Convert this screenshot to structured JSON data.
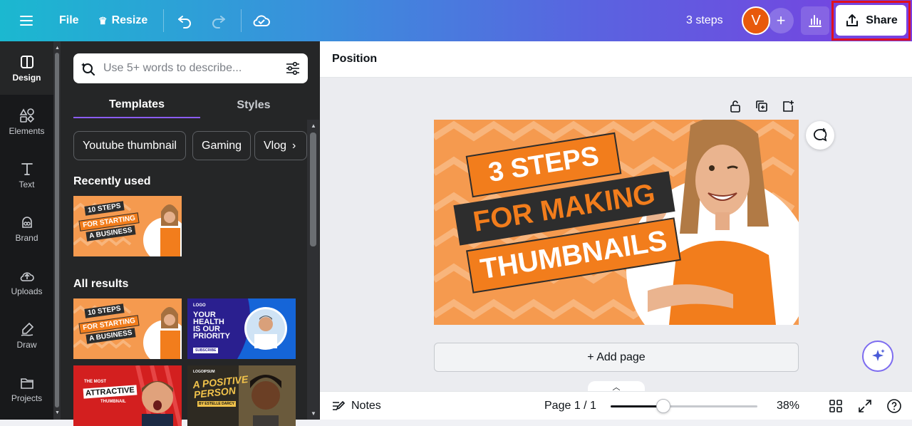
{
  "topbar": {
    "file_label": "File",
    "resize_label": "Resize",
    "doc_title": "3 steps",
    "avatar_letter": "V",
    "share_label": "Share",
    "highlight_color": "#e0101c"
  },
  "rail": {
    "items": [
      {
        "label": "Design",
        "icon": "design-icon"
      },
      {
        "label": "Elements",
        "icon": "elements-icon"
      },
      {
        "label": "Text",
        "icon": "text-icon"
      },
      {
        "label": "Brand",
        "icon": "brand-icon"
      },
      {
        "label": "Uploads",
        "icon": "uploads-icon"
      },
      {
        "label": "Draw",
        "icon": "draw-icon"
      },
      {
        "label": "Projects",
        "icon": "projects-icon"
      }
    ]
  },
  "panel": {
    "search_placeholder": "Use 5+ words to describe...",
    "tabs": [
      "Templates",
      "Styles"
    ],
    "chips": [
      "Youtube thumbnail",
      "Gaming",
      "Vlog"
    ],
    "recently_used_title": "Recently used",
    "all_results_title": "All results",
    "thumbs": {
      "t1": {
        "line1": "10 STEPS",
        "line2": "FOR STARTING",
        "line3": "A BUSINESS"
      },
      "t2": {
        "logo": "LOGO",
        "line1": "YOUR",
        "line2": "HEALTH",
        "line3": "IS OUR",
        "line4": "PRIORITY",
        "cta": "SUBSCRIBE"
      },
      "t3": {
        "small": "THE MOST",
        "big": "ATTRACTIVE",
        "sub": "THUMBNAIL"
      },
      "t4": {
        "brand": "LOGOIPSUM",
        "line1": "A POSITIVE",
        "line2": "PERSON",
        "sub": "BY ESTELLE DARCY"
      }
    }
  },
  "editor": {
    "position_label": "Position",
    "design": {
      "line1": "3 STEPS",
      "line2": "FOR MAKING",
      "line3": "THUMBNAILS"
    },
    "add_page_label": "+ Add page"
  },
  "bottombar": {
    "notes_label": "Notes",
    "page_label": "Page 1 / 1",
    "zoom_label": "38%",
    "zoom_slider_fraction": 0.36
  }
}
